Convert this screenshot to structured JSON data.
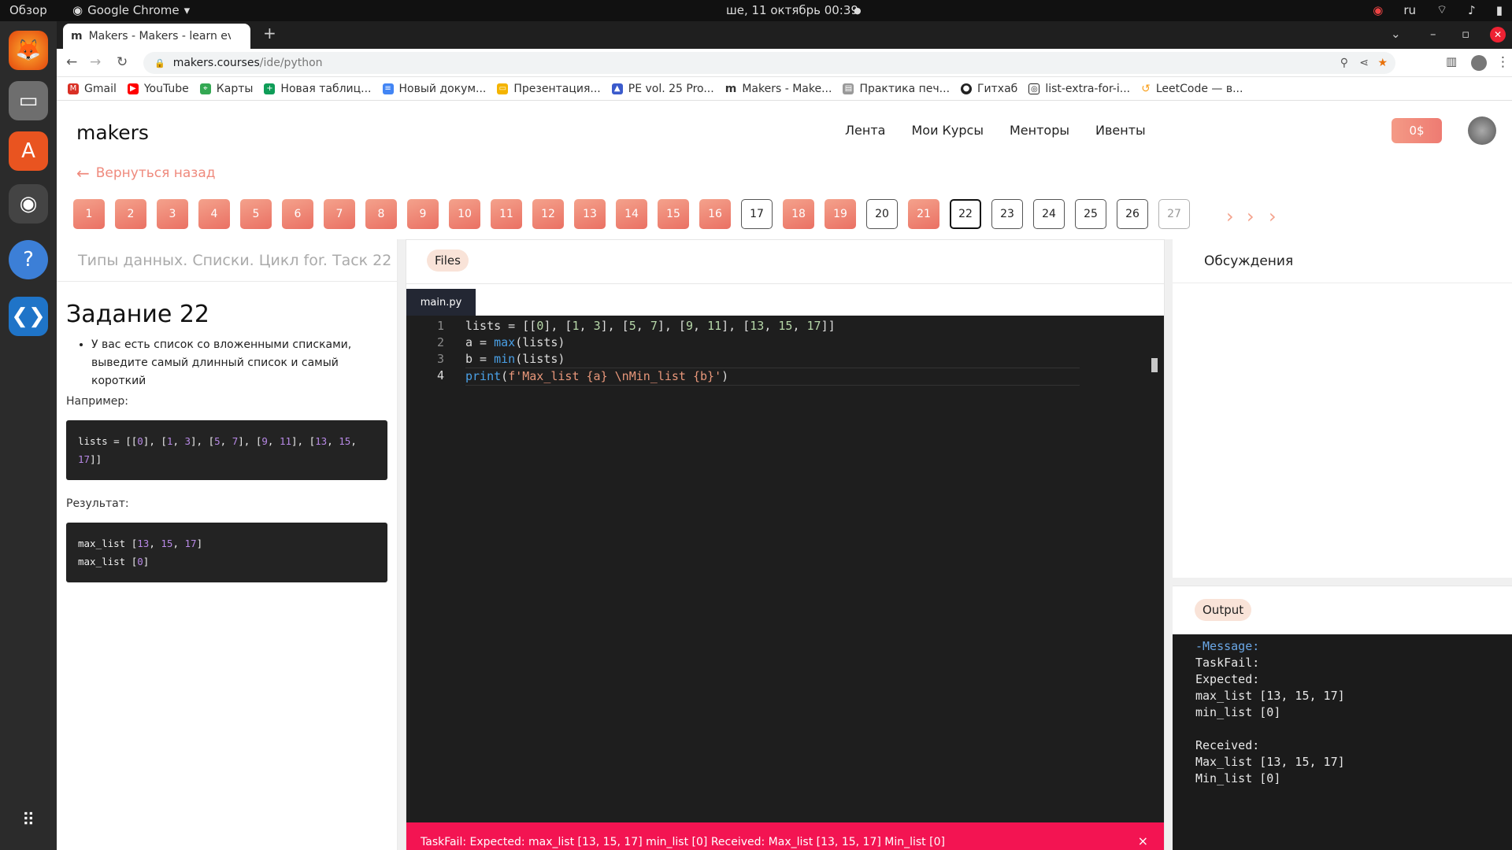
{
  "os": {
    "activities": "Обзор",
    "app": "Google Chrome",
    "datetime": "ше, 11 октябрь  00:39",
    "lang": "ru"
  },
  "browser": {
    "tab_title": "Makers - Makers - learn ev",
    "url_host": "makers.courses",
    "url_path": "/ide/python",
    "bookmarks": [
      "Gmail",
      "YouTube",
      "Карты",
      "Новая таблиц...",
      "Новый докум...",
      "Презентация...",
      "PE vol. 25 Pro...",
      "Makers - Make...",
      "Практика печ...",
      "Гитхаб",
      "list-extra-for-i...",
      "LeetCode — в..."
    ]
  },
  "site": {
    "logo": "makers",
    "nav": [
      "Лента",
      "Мои Курсы",
      "Менторы",
      "Ивенты"
    ],
    "balance": "0$",
    "back": "Вернуться назад",
    "steps": [
      "1",
      "2",
      "3",
      "4",
      "5",
      "6",
      "7",
      "8",
      "9",
      "10",
      "11",
      "12",
      "13",
      "14",
      "15",
      "16",
      "17",
      "18",
      "19",
      "20",
      "21",
      "22",
      "23",
      "24",
      "25",
      "26",
      "27"
    ]
  },
  "task": {
    "header": "Типы данных. Списки. Цикл for. Таск 22",
    "title": "Задание 22",
    "bullet": "У вас есть список со вложенными списками, выведите самый длинный список и самый короткий",
    "example_label": "Например:",
    "example_code": "lists = [[0], [1, 3], [5, 7], [9, 11], [13, 15, 17]]",
    "result_label": "Результат:",
    "result_line1": "max_list [13, 15, 17]",
    "result_line2": "max_list [0]"
  },
  "editor": {
    "files_label": "Files",
    "filename": "main.py",
    "line_numbers": [
      "1",
      "2",
      "3",
      "4"
    ],
    "lines": [
      "lists = [[0], [1, 3], [5, 7], [9, 11], [13, 15, 17]]",
      "a = max(lists)",
      "b = min(lists)",
      "print(f'Max_list {a} \\nMin_list {b}')"
    ],
    "error": "TaskFail: Expected: max_list [13, 15, 17] min_list [0] Received: Max_list [13, 15, 17] Min_list [0]",
    "close": "×"
  },
  "discussion": {
    "title": "Обсуждения"
  },
  "output": {
    "label": "Output",
    "message": "-Message:",
    "text": "TaskFail:\nExpected:\nmax_list [13, 15, 17]\nmin_list [0]\n\nReceived:\nMax_list [13, 15, 17]\nMin_list [0]"
  },
  "colors": {
    "accent": "#ef8a7d",
    "error": "#f31452",
    "editor_bg": "#1e1e1e"
  }
}
